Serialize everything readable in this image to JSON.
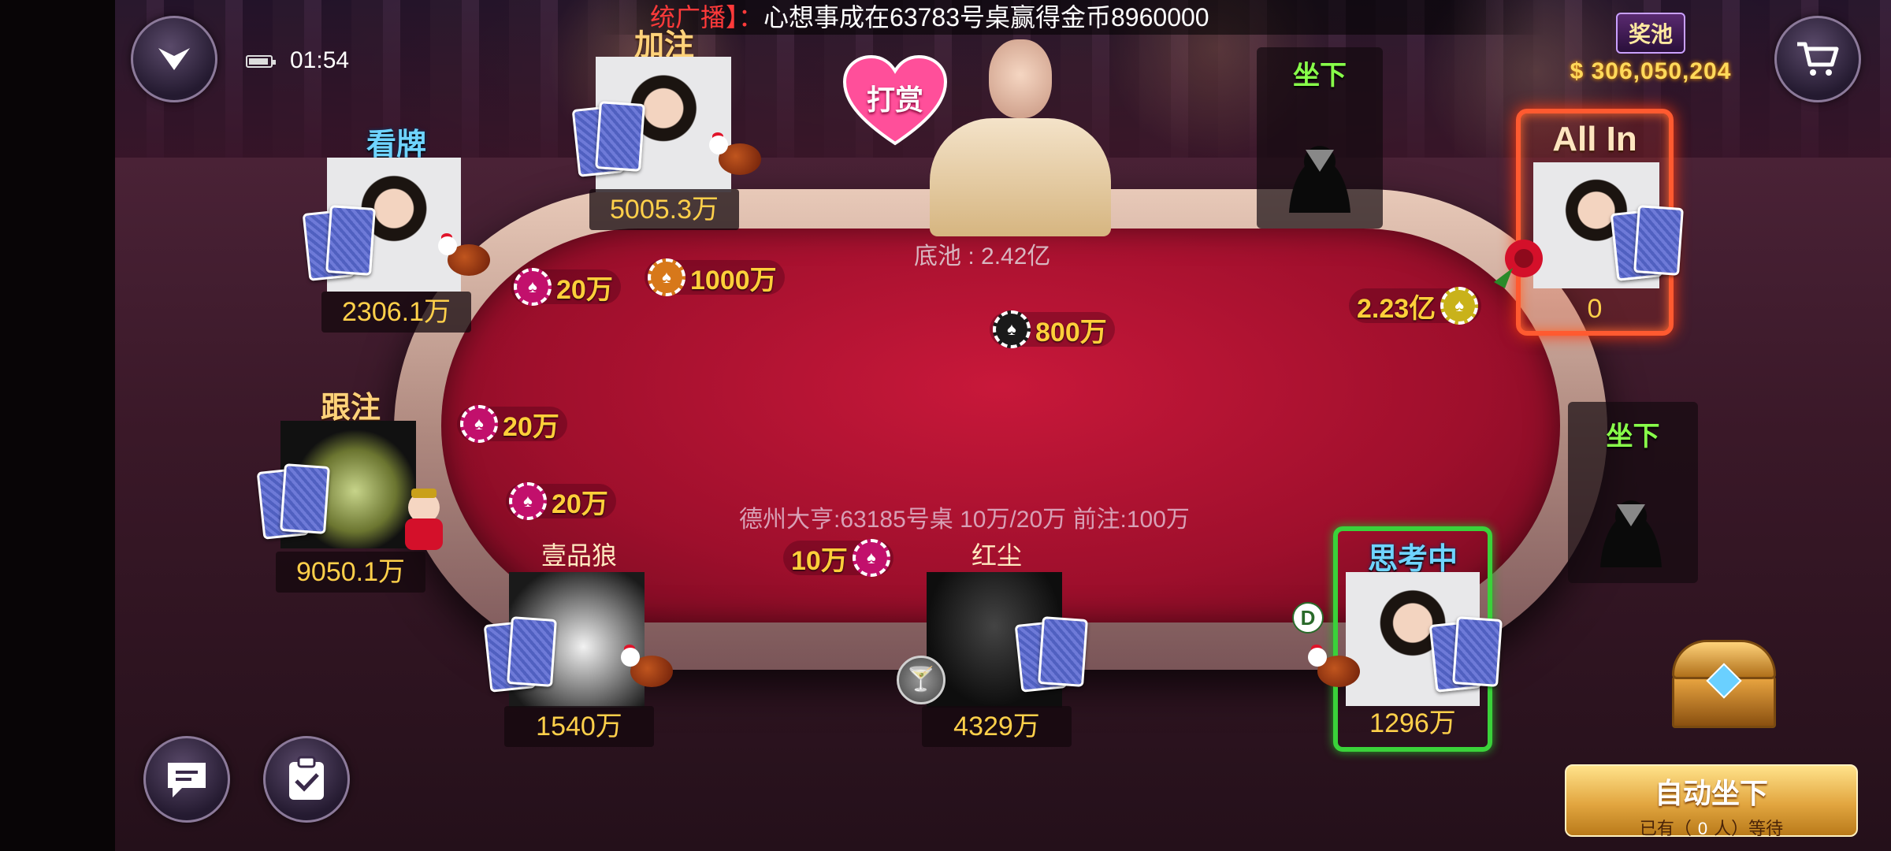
{
  "broadcast": {
    "tag": "统广播】：",
    "message": "心想事成在63783号桌赢得金币8960000"
  },
  "status_bar": {
    "time": "01:54"
  },
  "jackpot": {
    "title": "奖池",
    "amount": "$ 306,050,204"
  },
  "tip_button": {
    "label": "打赏"
  },
  "pot": {
    "label": "底池 : 2.42亿"
  },
  "table_info": "德州大亨:63185号桌  10万/20万  前注:100万",
  "seats": {
    "top_left": {
      "status": "看牌",
      "chips": "2306.1万"
    },
    "top_center": {
      "status": "加注",
      "chips": "5005.3万"
    },
    "allin": {
      "status": "All In",
      "chips": "0"
    },
    "left": {
      "status": "跟注",
      "chips": "9050.1万"
    },
    "bottom_left": {
      "name": "壹品狼",
      "chips": "1540万"
    },
    "bottom_center": {
      "name": "红尘",
      "chips": "4329万"
    },
    "thinking": {
      "status": "思考中",
      "chips": "1296万"
    }
  },
  "empty_seats": {
    "top_right": "坐下",
    "right": "坐下"
  },
  "bets": {
    "b1": "20万",
    "b2": "1000万",
    "b3": "800万",
    "b4": "2.23亿",
    "b5": "20万",
    "b6": "20万",
    "b7": "10万"
  },
  "dealer_button": "D",
  "auto_sit": {
    "title": "自动坐下",
    "prefix": "已有（",
    "count": "0",
    "suffix": "人）等待"
  },
  "colors": {
    "felt": "#b0123a",
    "gold": "#ffcf3a",
    "allin": "#ff5a30",
    "thinking": "#3ad23a",
    "sit": "#88ff4a"
  },
  "icons": [
    "collapse-menu-icon",
    "battery-icon",
    "shop-cart-icon",
    "chat-icon",
    "task-clipboard-icon",
    "treasure-chest-icon",
    "cocktail-icon",
    "rooster-icon"
  ]
}
